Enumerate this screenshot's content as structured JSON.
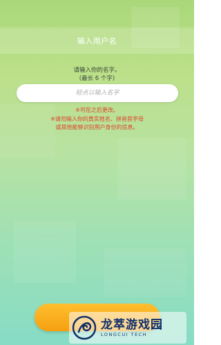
{
  "header": {
    "title": "输入用户名"
  },
  "form": {
    "prompt_line1": "请输入你的名字。",
    "prompt_line2": "(最长 6 个字)",
    "name_placeholder": "轻点以输入名字"
  },
  "notices": {
    "line1": "※可在之后更改。",
    "line2": "※请勿输入你的真实姓名、拼音首字母",
    "line3": "或其他能够识别用户身份的信息。"
  },
  "confirm": {
    "label": ""
  },
  "watermark": {
    "name": "龙萃游戏园",
    "subtitle": "LONGCUI TECH"
  },
  "colors": {
    "warning": "#e0402a",
    "button": "#f5a515",
    "watermark": "#0f2f6b"
  }
}
